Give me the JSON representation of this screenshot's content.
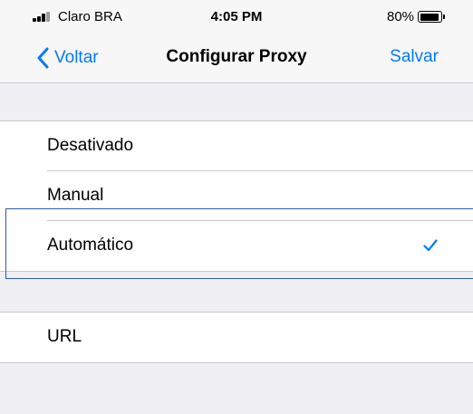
{
  "status_bar": {
    "carrier": "Claro BRA",
    "time": "4:05 PM",
    "battery_percent": "80%",
    "battery_level": 0.8,
    "signal_icon": "signal-bars-icon",
    "battery_icon": "battery-icon"
  },
  "nav": {
    "back_label": "Voltar",
    "title": "Configurar Proxy",
    "save_label": "Salvar",
    "back_icon": "chevron-left-icon"
  },
  "proxy_options": [
    {
      "label": "Desativado",
      "selected": false
    },
    {
      "label": "Manual",
      "selected": false
    },
    {
      "label": "Automático",
      "selected": true
    }
  ],
  "url_section": {
    "label": "URL"
  },
  "colors": {
    "accent": "#007aff",
    "background": "#efeff4",
    "separator": "#c8c7cc"
  }
}
